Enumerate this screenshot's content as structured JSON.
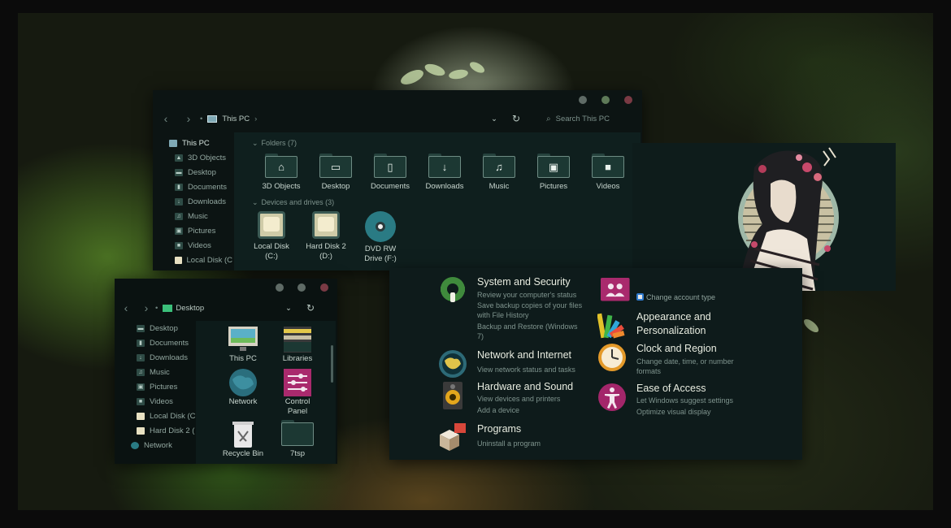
{
  "explorer_main": {
    "breadcrumb": "This PC",
    "search_placeholder": "Search This PC",
    "sidebar": [
      {
        "label": "This PC",
        "icon": "monitor-icon"
      },
      {
        "label": "3D Objects",
        "icon": "cube-icon"
      },
      {
        "label": "Desktop",
        "icon": "desktop-icon"
      },
      {
        "label": "Documents",
        "icon": "document-icon"
      },
      {
        "label": "Downloads",
        "icon": "download-icon"
      },
      {
        "label": "Music",
        "icon": "music-icon"
      },
      {
        "label": "Pictures",
        "icon": "picture-icon"
      },
      {
        "label": "Videos",
        "icon": "video-icon"
      },
      {
        "label": "Local Disk (C",
        "icon": "drive-icon"
      }
    ],
    "folders_header": "Folders (7)",
    "folders": [
      {
        "label": "3D Objects",
        "glyph": "⌂"
      },
      {
        "label": "Desktop",
        "glyph": "▭"
      },
      {
        "label": "Documents",
        "glyph": "▯"
      },
      {
        "label": "Downloads",
        "glyph": "↓"
      },
      {
        "label": "Music",
        "glyph": "♫"
      },
      {
        "label": "Pictures",
        "glyph": "▣"
      },
      {
        "label": "Videos",
        "glyph": "■"
      }
    ],
    "drives_header": "Devices and drives (3)",
    "drives": [
      {
        "line1": "Local Disk",
        "line2": "(C:)"
      },
      {
        "line1": "Hard Disk 2",
        "line2": "(D:)"
      },
      {
        "line1": "DVD RW",
        "line2": "Drive (F:)"
      }
    ]
  },
  "explorer_desktop": {
    "breadcrumb": "Desktop",
    "sidebar": [
      {
        "label": "Desktop"
      },
      {
        "label": "Documents"
      },
      {
        "label": "Downloads"
      },
      {
        "label": "Music"
      },
      {
        "label": "Pictures"
      },
      {
        "label": "Videos"
      },
      {
        "label": "Local Disk (C"
      },
      {
        "label": "Hard Disk 2 ("
      },
      {
        "label": "Network"
      }
    ],
    "items": [
      {
        "line1": "This PC",
        "line2": ""
      },
      {
        "line1": "Libraries",
        "line2": ""
      },
      {
        "line1": "Network",
        "line2": ""
      },
      {
        "line1": "Control",
        "line2": "Panel"
      },
      {
        "line1": "Recycle Bin",
        "line2": ""
      },
      {
        "line1": "7tsp",
        "line2": ""
      }
    ]
  },
  "control_panel": {
    "system": {
      "title": "System and Security",
      "sub": [
        "Review your computer's status",
        "Save backup copies of your files",
        "with File History",
        "Backup and Restore (Windows",
        "7)"
      ]
    },
    "network": {
      "title": "Network and Internet",
      "sub": [
        "View network status and tasks"
      ]
    },
    "hardware": {
      "title": "Hardware and Sound",
      "sub": [
        "View devices and printers",
        "Add a device"
      ]
    },
    "programs": {
      "title": "Programs",
      "sub": [
        "Uninstall a program"
      ]
    },
    "user": {
      "sub": "Change account type"
    },
    "appearance": {
      "title": [
        "Appearance and",
        "Personalization"
      ]
    },
    "clock": {
      "title": "Clock and Region",
      "sub": [
        "Change date, time, or number",
        "formats"
      ]
    },
    "ease": {
      "title": "Ease of Access",
      "sub": [
        "Let Windows suggest settings",
        "Optimize visual display"
      ]
    }
  },
  "colors": {
    "window_bg": "#0d1817",
    "accent_teal": "#2a7b84",
    "dot_gray": "#5f6b66",
    "dot_green": "#5e7a58",
    "dot_red": "#7a3a44"
  }
}
